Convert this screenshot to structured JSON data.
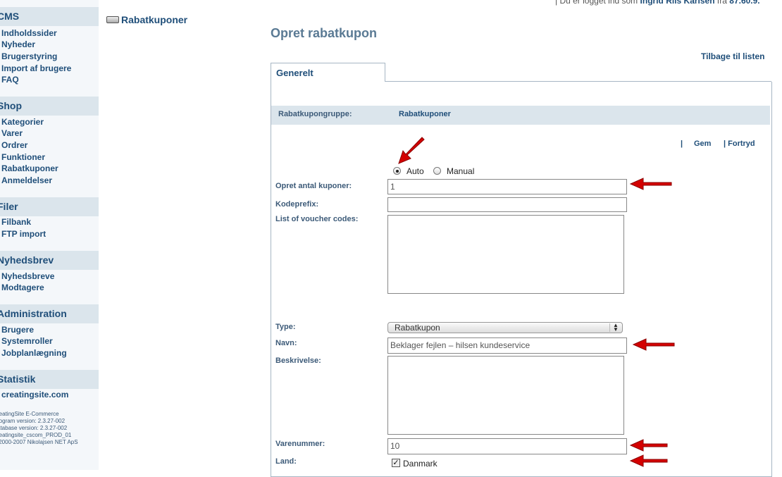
{
  "header": {
    "login_prefix": "| Du er logget ind som",
    "user": "Ingrid Riis Karlsen",
    "from": "fra",
    "ip": "87.60.9."
  },
  "sidebar": {
    "sections": [
      {
        "title": "CMS",
        "items": [
          "Indholdssider",
          "Nyheder",
          "Brugerstyring",
          "Import af brugere",
          "FAQ"
        ]
      },
      {
        "title": "Shop",
        "items": [
          "Kategorier",
          "Varer",
          "Ordrer",
          "Funktioner",
          "Rabatkuponer",
          "Anmeldelser"
        ]
      },
      {
        "title": "Filer",
        "items": [
          "Filbank",
          "FTP import"
        ]
      },
      {
        "title": "Nyhedsbrev",
        "items": [
          "Nyhedsbreve",
          "Modtagere"
        ]
      },
      {
        "title": "Administration",
        "items": [
          "Brugere",
          "Systemroller",
          "Jobplanlægning"
        ]
      },
      {
        "title": "Statistik",
        "items": [
          "creatingsite.com"
        ]
      }
    ],
    "version_info": "reatingSite E-Commerce\nrogram version: 2.3.27-002\natabase version: 2.3.27-002\nreatingsite_cscom_PROD_01\n 2000-2007 Nikolajsen NET ApS"
  },
  "breadcrumb": "Rabatkuponer",
  "page_title": "Opret rabatkupon",
  "back_link": "Tilbage til listen",
  "tab": "Generelt",
  "form": {
    "group_label": "Rabatkupongruppe:",
    "group_value": "Rabatkuponer",
    "actions": {
      "sep": "|",
      "save": "Gem",
      "cancel": "| Fortryd"
    },
    "mode": {
      "auto": "Auto",
      "manual": "Manual",
      "selected": "Auto"
    },
    "count_label": "Opret antal kuponer:",
    "count_value": "1",
    "prefix_label": "Kodeprefix:",
    "prefix_value": "",
    "codes_label": "List of voucher codes:",
    "type_label": "Type:",
    "type_value": "Rabatkupon",
    "name_label": "Navn:",
    "name_value": "Beklager fejlen – hilsen kundeservice",
    "desc_label": "Beskrivelse:",
    "itemno_label": "Varenummer:",
    "itemno_value": "10",
    "country_label": "Land:",
    "country_value": "Danmark",
    "country_checked": true
  },
  "colors": {
    "accent": "#1f4e79",
    "sidebar_head": "#dbe5ec",
    "annotation_arrow": "#d40000"
  }
}
